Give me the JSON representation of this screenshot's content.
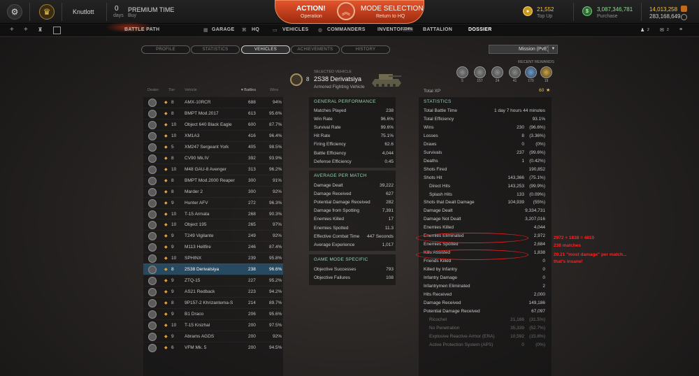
{
  "topbar": {
    "user": "Knutlott",
    "days_value": "0",
    "days_label": "days",
    "premium_title": "PREMIUM TIME",
    "premium_sub": "Buy",
    "action_title": "ACTION!",
    "action_sub": "Operation",
    "mode_title": "MODE SELECTION",
    "mode_sub": "Return to HQ",
    "gold": "21,552",
    "gold_sub": "Top Up",
    "credits": "3,087,346,781",
    "credits_sub": "Purchase",
    "xp1": "14,013,258",
    "xp2": "283,168,649"
  },
  "nav": {
    "battle_path": "BATTLE PATH",
    "garage": "GARAGE",
    "hq": "HQ",
    "vehicles": "VEHICLES",
    "commanders": "COMMANDERS",
    "inventory": "INVENTORY",
    "inventory_pct": "224%",
    "battalion": "BATTALION",
    "dossier": "DOSSIER",
    "friends_count": "2",
    "chat_count": "2"
  },
  "tabs": [
    "PROFILE",
    "STATISTICS",
    "VEHICLES",
    "ACHIEVEMENTS",
    "HISTORY"
  ],
  "mode_select": "Mission (PvE)",
  "recent_rewards": {
    "label": "RECENT REWARDS",
    "counts": [
      "5",
      "157",
      "24",
      "41",
      "170",
      "19"
    ]
  },
  "vehicle": {
    "tier": "8",
    "label": "SELECTED VEHICLE",
    "name": "2S38 Derivatsiya",
    "class": "Armored Fighting Vehicle",
    "total_xp_label": "Total XP",
    "total_xp": "60"
  },
  "table": {
    "headers": [
      "Dealer",
      "Tier",
      "Vehicle",
      "▾ Battles",
      "Wins"
    ],
    "rows": [
      [
        "8",
        "AMX-10RCR",
        "688",
        "94%"
      ],
      [
        "8",
        "BMPT Mod.2017",
        "613",
        "95.6%"
      ],
      [
        "10",
        "Object 640 Black Eagle",
        "600",
        "87.7%"
      ],
      [
        "10",
        "XM1A3",
        "416",
        "96.4%"
      ],
      [
        "5",
        "XM247 Sergeant York",
        "405",
        "98.5%"
      ],
      [
        "8",
        "CV90 Mk.IV",
        "392",
        "93.9%"
      ],
      [
        "10",
        "M48 GAU-8 Avenger",
        "313",
        "96.2%"
      ],
      [
        "8",
        "BMPT Mod.2000 Reaper",
        "300",
        "91%"
      ],
      [
        "8",
        "Marder 2",
        "300",
        "92%"
      ],
      [
        "9",
        "Hunter AFV",
        "272",
        "96.3%"
      ],
      [
        "10",
        "T-15 Armata",
        "268",
        "90.3%"
      ],
      [
        "10",
        "Object 195",
        "265",
        "97%"
      ],
      [
        "9",
        "T249 Vigilante",
        "249",
        "92%"
      ],
      [
        "9",
        "M113 Hellfire",
        "246",
        "87.4%"
      ],
      [
        "10",
        "SPHINX",
        "239",
        "95.8%"
      ],
      [
        "8",
        "2S38 Derivatsiya",
        "238",
        "96.6%"
      ],
      [
        "9",
        "ZTQ-15",
        "227",
        "95.2%"
      ],
      [
        "9",
        "AS21 Redback",
        "223",
        "94.2%"
      ],
      [
        "8",
        "9P157-2 Khrizantema-S",
        "214",
        "89.7%"
      ],
      [
        "9",
        "B1 Draco",
        "206",
        "95.6%"
      ],
      [
        "10",
        "T-15 Knizhal",
        "200",
        "97.5%"
      ],
      [
        "9",
        "Abrams AGDS",
        "200",
        "92%"
      ],
      [
        "6",
        "VFM Mk. 5",
        "200",
        "94.5%"
      ]
    ]
  },
  "general": {
    "title": "GENERAL PERFORMANCE",
    "rows": [
      [
        "Matches Played",
        "238"
      ],
      [
        "Win Rate",
        "96.6%"
      ],
      [
        "Survival Rate",
        "99.6%"
      ],
      [
        "Hit Rate",
        "75.1%"
      ],
      [
        "Firing Efficiency",
        "62.6"
      ],
      [
        "Battle Efficiency",
        "4,044"
      ],
      [
        "Defense Efficiency",
        "0.45"
      ]
    ]
  },
  "average": {
    "title": "AVERAGE PER MATCH",
    "rows": [
      [
        "Damage Dealt",
        "39,222"
      ],
      [
        "Damage Received",
        "627"
      ],
      [
        "Potential Damage Received",
        "282"
      ],
      [
        "Damage from Spotting",
        "7,391"
      ],
      [
        "Enemies Killed",
        "17"
      ],
      [
        "Enemies Spotted",
        "11.3"
      ],
      [
        "Effective Combat Time",
        "447 Seconds"
      ],
      [
        "Average Experience",
        "1,017"
      ]
    ]
  },
  "gamemode": {
    "title": "GAME MODE SPECIFIC",
    "rows": [
      [
        "Objective Successes",
        "793"
      ],
      [
        "Objective Failures",
        "108"
      ]
    ]
  },
  "statistics": {
    "title": "STATISTICS",
    "rows": [
      [
        "Total Battle Time",
        "1 day 7 hours 44 minutes",
        ""
      ],
      [
        "Total Efficiency",
        "93.1%",
        ""
      ],
      [
        "Wins",
        "230",
        "(96.6%)"
      ],
      [
        "Losses",
        "8",
        "(3.36%)"
      ],
      [
        "Draws",
        "0",
        "(0%)"
      ],
      [
        "Survivals",
        "237",
        "(99.6%)"
      ],
      [
        "Deaths",
        "1",
        "(0.42%)"
      ],
      [
        "Shots Fired",
        "190,852",
        ""
      ],
      [
        "Shots Hit",
        "143,366",
        "(75.1%)"
      ],
      [
        "Direct Hits",
        "143,253",
        "(99.9%)"
      ],
      [
        "Splash Hits",
        "133",
        "(0.09%)"
      ],
      [
        "Shots that Dealt Damage",
        "104,939",
        "(55%)"
      ],
      [
        "Damage Dealt",
        "9,334,731",
        ""
      ],
      [
        "Damage Not Dealt",
        "3,207,016",
        ""
      ],
      [
        "Enemies Killed",
        "4,044",
        ""
      ],
      [
        "Enemies Eliminated",
        "2,972",
        ""
      ],
      [
        "Enemies Spotted",
        "2,684",
        ""
      ],
      [
        "Kills Assisted",
        "1,838",
        ""
      ],
      [
        "Friends Killed",
        "0",
        ""
      ],
      [
        "Killed by Infantry",
        "0",
        ""
      ],
      [
        "Infantry Damage",
        "0",
        ""
      ],
      [
        "Infantrymen Eliminated",
        "2",
        ""
      ],
      [
        "Hits Received",
        "2,000",
        ""
      ],
      [
        "Damage Received",
        "149,186",
        ""
      ],
      [
        "Potential Damage Received",
        "67,097",
        ""
      ],
      [
        "Ricochet",
        "21,166",
        "(31.5%)"
      ],
      [
        "No Penetration",
        "35,339",
        "(52.7%)"
      ],
      [
        "Explosive Reactive Armor (ERA)",
        "10,592",
        "(15.8%)"
      ],
      [
        "Active Protection System (APS)",
        "0",
        "(0%)"
      ]
    ]
  },
  "annotations": [
    "2972 + 1838 = 4810",
    "238 matches",
    "20.21 \"most damage\" per match...",
    "that's insane!"
  ]
}
